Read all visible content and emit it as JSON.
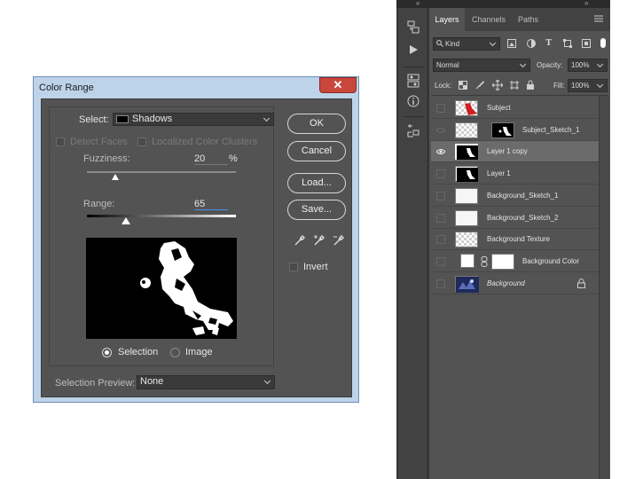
{
  "dialog": {
    "title": "Color Range",
    "close_glyph": "✕",
    "select_label": "Select:",
    "select_value": "Shadows",
    "detect_faces": "Detect Faces",
    "localized_clusters": "Localized Color Clusters",
    "fuzziness_label": "Fuzziness:",
    "fuzziness_value": "20",
    "fuzziness_unit": "%",
    "range_label": "Range:",
    "range_value": "65",
    "radio_selection": "Selection",
    "radio_image": "Image",
    "preview_label": "Selection Preview:",
    "preview_value": "None",
    "ok": "OK",
    "cancel": "Cancel",
    "load": "Load...",
    "save": "Save...",
    "invert": "Invert"
  },
  "panel": {
    "tabs": [
      "Layers",
      "Channels",
      "Paths"
    ],
    "filter_kind": "Kind",
    "blend_mode": "Normal",
    "opacity_label": "Opacity:",
    "opacity_value": "100%",
    "lock_label": "Lock:",
    "fill_label": "Fill:",
    "fill_value": "100%",
    "layers": [
      {
        "name": "Subject"
      },
      {
        "name": "Subject_Sketch_1"
      },
      {
        "name": "Layer 1 copy"
      },
      {
        "name": "Layer 1"
      },
      {
        "name": "Background_Sketch_1"
      },
      {
        "name": "Background_Sketch_2"
      },
      {
        "name": "Background Texture"
      },
      {
        "name": "Background Color"
      },
      {
        "name": "Background"
      }
    ]
  }
}
